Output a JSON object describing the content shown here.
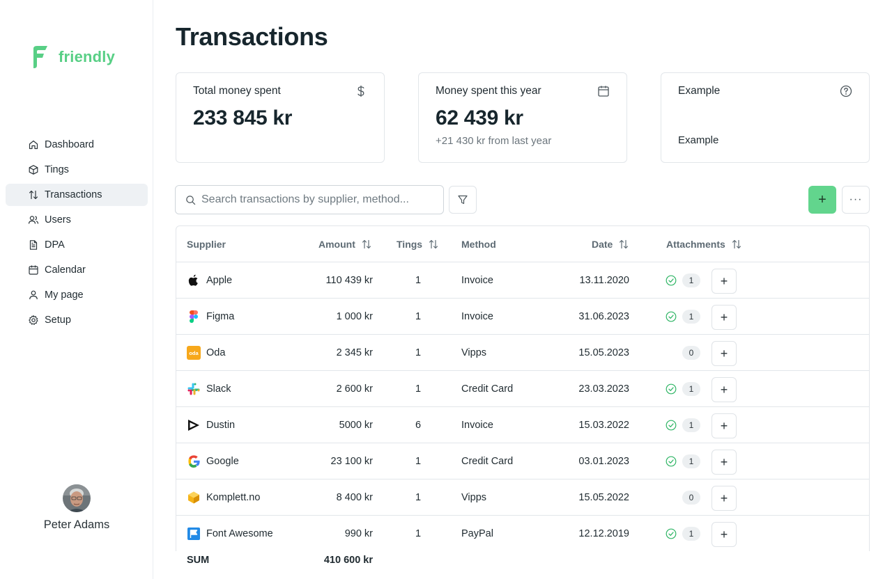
{
  "app": {
    "name": "friendly",
    "brand_color": "#58cf85"
  },
  "sidebar": {
    "items": [
      {
        "label": "Dashboard",
        "icon": "home-icon",
        "active": false
      },
      {
        "label": "Tings",
        "icon": "box-icon",
        "active": false
      },
      {
        "label": "Transactions",
        "icon": "arrows-up-down-icon",
        "active": true
      },
      {
        "label": "Users",
        "icon": "users-icon",
        "active": false
      },
      {
        "label": "DPA",
        "icon": "document-icon",
        "active": false
      },
      {
        "label": "Calendar",
        "icon": "calendar-icon",
        "active": false
      },
      {
        "label": "My page",
        "icon": "user-icon",
        "active": false
      },
      {
        "label": "Setup",
        "icon": "gear-icon",
        "active": false
      }
    ],
    "user": {
      "name": "Peter Adams"
    }
  },
  "page": {
    "title": "Transactions"
  },
  "cards": [
    {
      "label": "Total money spent",
      "value": "233 845 kr",
      "sub": "",
      "icon": "dollar-icon"
    },
    {
      "label": "Money spent this year",
      "value": "62 439 kr",
      "sub": "+21 430 kr from last year",
      "icon": "calendar-icon"
    },
    {
      "label": "Example",
      "value": "",
      "sub": "Example",
      "icon": "question-circle-icon"
    }
  ],
  "toolbar": {
    "search_placeholder": "Search transactions by supplier, method...",
    "add_label": "+",
    "more_label": "···"
  },
  "table": {
    "headers": {
      "supplier": "Supplier",
      "amount": "Amount",
      "tings": "Tings",
      "method": "Method",
      "date": "Date",
      "attachments": "Attachments"
    },
    "rows": [
      {
        "supplier": "Apple",
        "amount": "110 439 kr",
        "tings": "1",
        "method": "Invoice",
        "date": "13.11.2020",
        "verified": true,
        "attachments": "1"
      },
      {
        "supplier": "Figma",
        "amount": "1 000 kr",
        "tings": "1",
        "method": "Invoice",
        "date": "31.06.2023",
        "verified": true,
        "attachments": "1"
      },
      {
        "supplier": "Oda",
        "amount": "2 345 kr",
        "tings": "1",
        "method": "Vipps",
        "date": "15.05.2023",
        "verified": false,
        "attachments": "0"
      },
      {
        "supplier": "Slack",
        "amount": "2 600 kr",
        "tings": "1",
        "method": "Credit Card",
        "date": "23.03.2023",
        "verified": true,
        "attachments": "1"
      },
      {
        "supplier": "Dustin",
        "amount": "5000 kr",
        "tings": "6",
        "method": "Invoice",
        "date": "15.03.2022",
        "verified": true,
        "attachments": "1"
      },
      {
        "supplier": "Google",
        "amount": "23 100 kr",
        "tings": "1",
        "method": "Credit Card",
        "date": "03.01.2023",
        "verified": true,
        "attachments": "1"
      },
      {
        "supplier": "Komplett.no",
        "amount": "8 400 kr",
        "tings": "1",
        "method": "Vipps",
        "date": "15.05.2022",
        "verified": false,
        "attachments": "0"
      },
      {
        "supplier": "Font Awesome",
        "amount": "990 kr",
        "tings": "1",
        "method": "PayPal",
        "date": "12.12.2019",
        "verified": true,
        "attachments": "1"
      }
    ],
    "sum": {
      "label": "SUM",
      "value": "410 600 kr"
    },
    "logo_text_oda": "oda"
  }
}
